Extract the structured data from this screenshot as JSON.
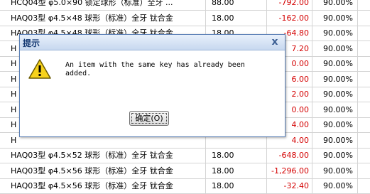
{
  "grid": {
    "rows": [
      {
        "name": "HCQ04型 φ5.0×90 锁定球形（标准）全牙 ...",
        "qty": "88.00",
        "amount": "-792.00",
        "rate": "90.00%"
      },
      {
        "name": "HAQ03型 φ4.5×48 球形（标准）全牙 钛合金",
        "qty": "18.00",
        "amount": "-162.00",
        "rate": "90.00%"
      },
      {
        "name": "HAQ03型 φ4.5×48 球形（标准）全牙 钛合金",
        "qty": "18.00",
        "amount": "-64.80",
        "rate": "90.00%"
      },
      {
        "name": "H",
        "qty": "",
        "amount": "7.20",
        "rate": "90.00%"
      },
      {
        "name": "H",
        "qty": "",
        "amount": "0.00",
        "rate": "90.00%"
      },
      {
        "name": "H",
        "qty": "",
        "amount": "6.00",
        "rate": "90.00%"
      },
      {
        "name": "H",
        "qty": "",
        "amount": "2.00",
        "rate": "90.00%"
      },
      {
        "name": "H",
        "qty": "",
        "amount": "0.00",
        "rate": "90.00%"
      },
      {
        "name": "H",
        "qty": "",
        "amount": "4.00",
        "rate": "90.00%"
      },
      {
        "name": "H",
        "qty": "",
        "amount": "4.00",
        "rate": "90.00%"
      },
      {
        "name": "HAQ03型 φ4.5×52 球形（标准）全牙 钛合金",
        "qty": "18.00",
        "amount": "-648.00",
        "rate": "90.00%"
      },
      {
        "name": "HAQ03型 φ4.5×56 球形（标准）全牙 钛合金",
        "qty": "18.00",
        "amount": "-1,296.00",
        "rate": "90.00%"
      },
      {
        "name": "HAQ03型 φ4.5×56 球形（标准）全牙 钛合金",
        "qty": "18.00",
        "amount": "-32.40",
        "rate": "90.00%"
      }
    ]
  },
  "dialog": {
    "title": "提示",
    "close_glyph": "x",
    "icon": "warning-icon",
    "message": "An item with the same key has already been\nadded.",
    "ok_label": "确定(O)"
  },
  "colors": {
    "negative_amount": "#d40000",
    "title_text": "#153a73",
    "dialog_border": "#5a7fb6",
    "warning_fill": "#f7d21c"
  }
}
